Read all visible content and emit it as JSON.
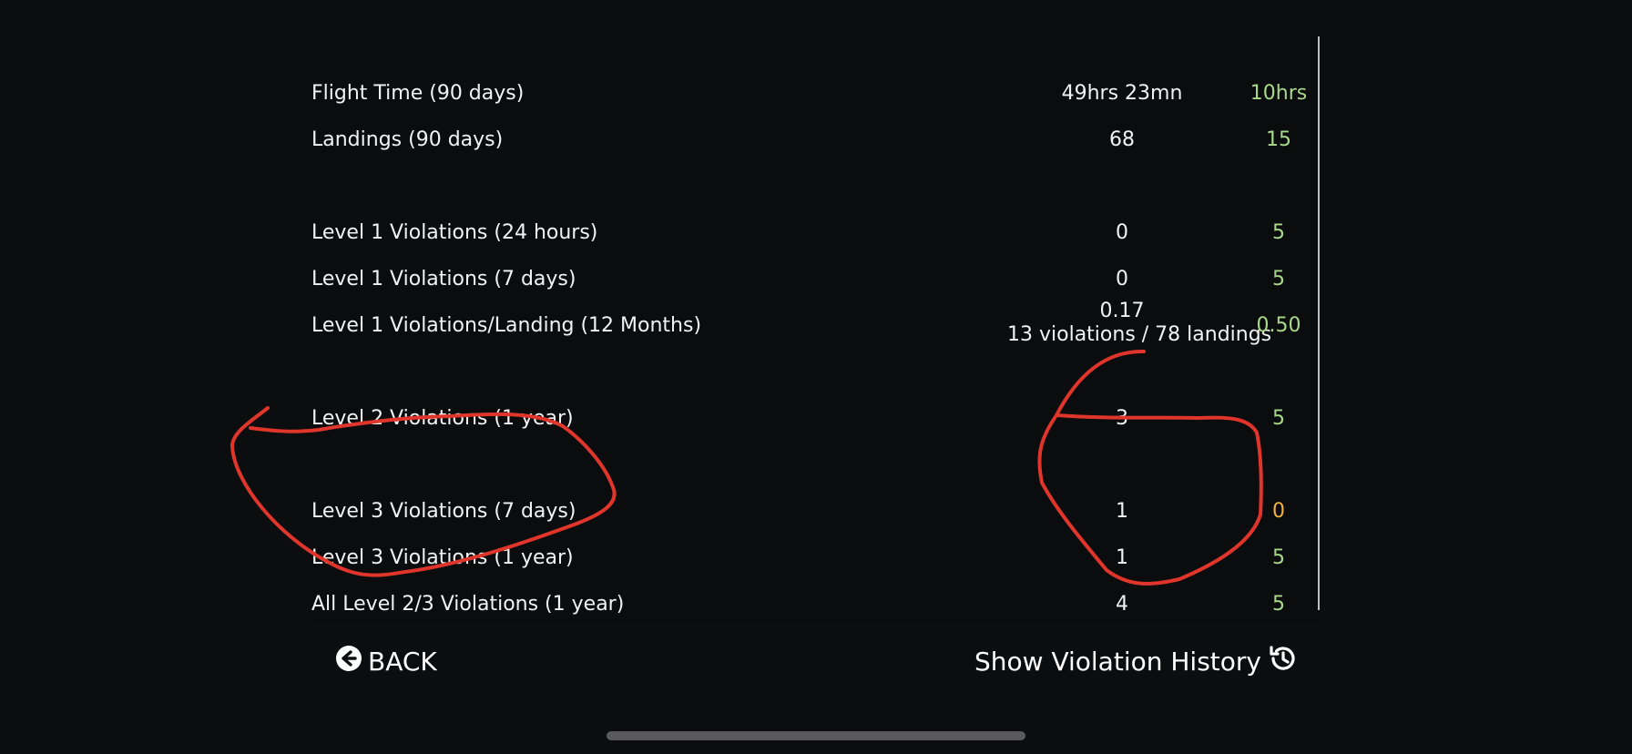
{
  "table": {
    "rows": [
      {
        "label": "Flight Time (90 days)",
        "value": "49hrs 23mn",
        "limit": "10hrs",
        "limit_color": "green"
      },
      {
        "label": "Landings (90 days)",
        "value": "68",
        "limit": "15",
        "limit_color": "green"
      },
      {
        "label": "Level 1 Violations (24 hours)",
        "value": "0",
        "limit": "5",
        "limit_color": "green"
      },
      {
        "label": "Level 1 Violations (7 days)",
        "value": "0",
        "limit": "5",
        "limit_color": "green"
      },
      {
        "label": "Level 1 Violations/Landing (12 Months)",
        "value_line1": "0.17",
        "value_line2": "13 violations / 78 landings",
        "limit": "0.50",
        "limit_color": "green"
      },
      {
        "label": "Level 2 Violations (1 year)",
        "value": "3",
        "limit": "5",
        "limit_color": "green"
      },
      {
        "label": "Level 3 Violations (7 days)",
        "value": "1",
        "limit": "0",
        "limit_color": "orange"
      },
      {
        "label": "Level 3 Violations (1 year)",
        "value": "1",
        "limit": "5",
        "limit_color": "green"
      },
      {
        "label": "All Level 2/3 Violations (1 year)",
        "value": "4",
        "limit": "5",
        "limit_color": "green"
      }
    ]
  },
  "footer": {
    "back_label": "BACK",
    "history_label": "Show Violation History"
  },
  "icons": {
    "back": "arrow-left-circle-icon",
    "history": "history-icon"
  },
  "colors": {
    "background": "#0c0d0f",
    "limit_ok": "#a7d98a",
    "limit_warn": "#f0b23c",
    "annotation": "#e0352b"
  }
}
